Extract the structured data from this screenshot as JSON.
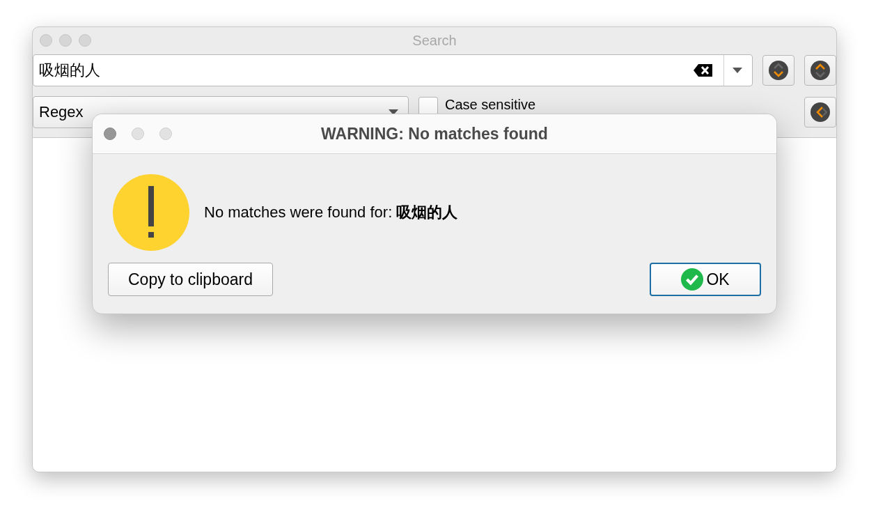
{
  "window": {
    "title": "Search"
  },
  "search": {
    "value": "吸烟的人"
  },
  "mode": {
    "value": "Regex"
  },
  "case_sensitive": {
    "label": "Case sensitive",
    "checked": false
  },
  "dialog": {
    "title": "WARNING: No matches found",
    "message": "No matches were found for: **吸烟的人**",
    "buttons": [
      {
        "label": "Copy to clipboard",
        "default": false
      },
      {
        "label": "OK",
        "default": true
      }
    ]
  }
}
